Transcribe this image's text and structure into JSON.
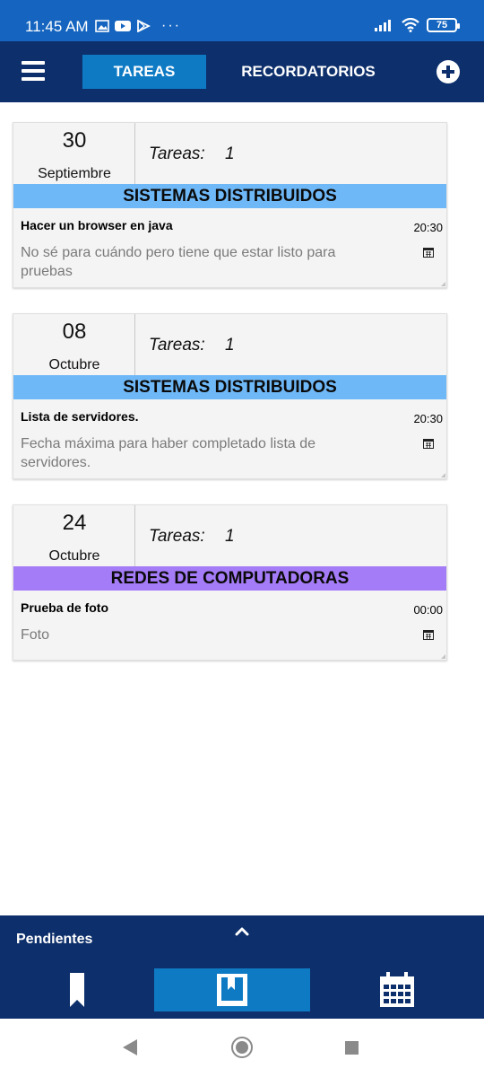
{
  "status_bar": {
    "time": "11:45 AM",
    "dots": "···",
    "battery": "75",
    "icons_left": [
      "gallery-icon",
      "youtube-icon",
      "play-store-icon"
    ],
    "icons_right": [
      "signal-icon",
      "wifi-icon",
      "battery-icon"
    ]
  },
  "app_bar": {
    "tabs": [
      {
        "label": "TAREAS",
        "active": true
      },
      {
        "label": "RECORDATORIOS",
        "active": false
      }
    ],
    "menu_icon": "hamburger-menu-icon",
    "add_icon": "add-circle-icon"
  },
  "cards": [
    {
      "day": "30",
      "month": "Septiembre",
      "tasks_label": "Tareas:",
      "tasks_count": "1",
      "subject": "SISTEMAS DISTRIBUIDOS",
      "subject_color": "#6fb8f7",
      "task_title": "Hacer un browser en java",
      "task_time": "20:30",
      "task_desc": "No sé para cuándo pero tiene que estar listo para pruebas"
    },
    {
      "day": "08",
      "month": "Octubre",
      "tasks_label": "Tareas:",
      "tasks_count": "1",
      "subject": "SISTEMAS DISTRIBUIDOS",
      "subject_color": "#6fb8f7",
      "task_title": "Lista de servidores.",
      "task_time": "20:30",
      "task_desc": "Fecha máxima para haber completado lista de servidores."
    },
    {
      "day": "24",
      "month": "Octubre",
      "tasks_label": "Tareas:",
      "tasks_count": "1",
      "subject": "REDES DE COMPUTADORAS",
      "subject_color": "#a57cf7",
      "task_title": "Prueba de foto",
      "task_time": "00:00",
      "task_desc": "Foto"
    }
  ],
  "bottom_bar": {
    "label": "Pendientes",
    "nav": [
      "bookmark-icon",
      "book-icon",
      "calendar-icon"
    ],
    "active_index": 1
  },
  "colors": {
    "status_bar": "#1565c0",
    "app_bar": "#0d2f6b",
    "active_tab": "#0e7ac4"
  }
}
